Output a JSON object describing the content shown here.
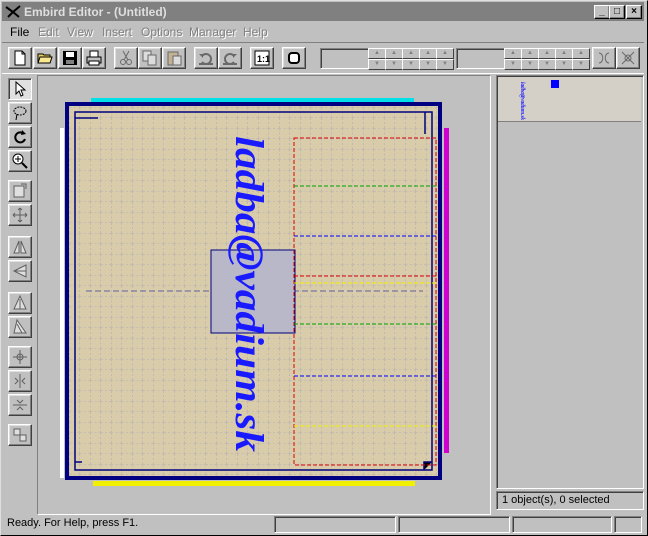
{
  "window": {
    "title": "Embird Editor - (Untitled)",
    "caption_buttons": {
      "minimize": "_",
      "maximize": "□",
      "close": "×"
    }
  },
  "menu": [
    {
      "label": "File",
      "enabled": true
    },
    {
      "label": "Edit",
      "enabled": false
    },
    {
      "label": "View",
      "enabled": false
    },
    {
      "label": "Insert",
      "enabled": false
    },
    {
      "label": "Options",
      "enabled": false
    },
    {
      "label": "Manager",
      "enabled": false
    },
    {
      "label": "Help",
      "enabled": false
    }
  ],
  "toolbar": {
    "buttons": [
      "new-file-icon",
      "open-folder-icon",
      "save-disk-icon",
      "print-icon",
      "cut-icon",
      "copy-icon",
      "paste-icon",
      "undo-icon",
      "redo-icon",
      "zoom-1to1-icon",
      "stop-icon"
    ],
    "spin_group_1": {
      "arrows": [
        "up",
        "down"
      ]
    },
    "spin_group_2": {
      "arrows": [
        "up",
        "down"
      ]
    }
  },
  "left_toolbar": [
    "select-arrow-icon",
    "lasso-select-icon",
    "rotate-icon",
    "zoom-in-icon",
    "resize-icon",
    "move-icon",
    "mirror-horizontal-icon",
    "mirror-vertical-icon",
    "skew-left-icon",
    "skew-right-icon",
    "align-center-icon",
    "align-vertical-icon",
    "align-horizontal-icon",
    "arrange-icon"
  ],
  "design": {
    "text": "ladba@vadium.sk",
    "text_color": "#1a1aff",
    "fabric_color": "#d8ccaa",
    "hoop_color": "#000080",
    "accent_colors": {
      "cyan": "#00e0e8",
      "magenta": "#d000d0",
      "yellow": "#f0f000",
      "red": "#e00000",
      "green": "#00a000",
      "blue": "#0000ff"
    }
  },
  "preview": {
    "label": "ladba@vadium.sk"
  },
  "status": {
    "message": "Ready. For Help, press F1.",
    "objects": "1 object(s), 0 selected"
  }
}
